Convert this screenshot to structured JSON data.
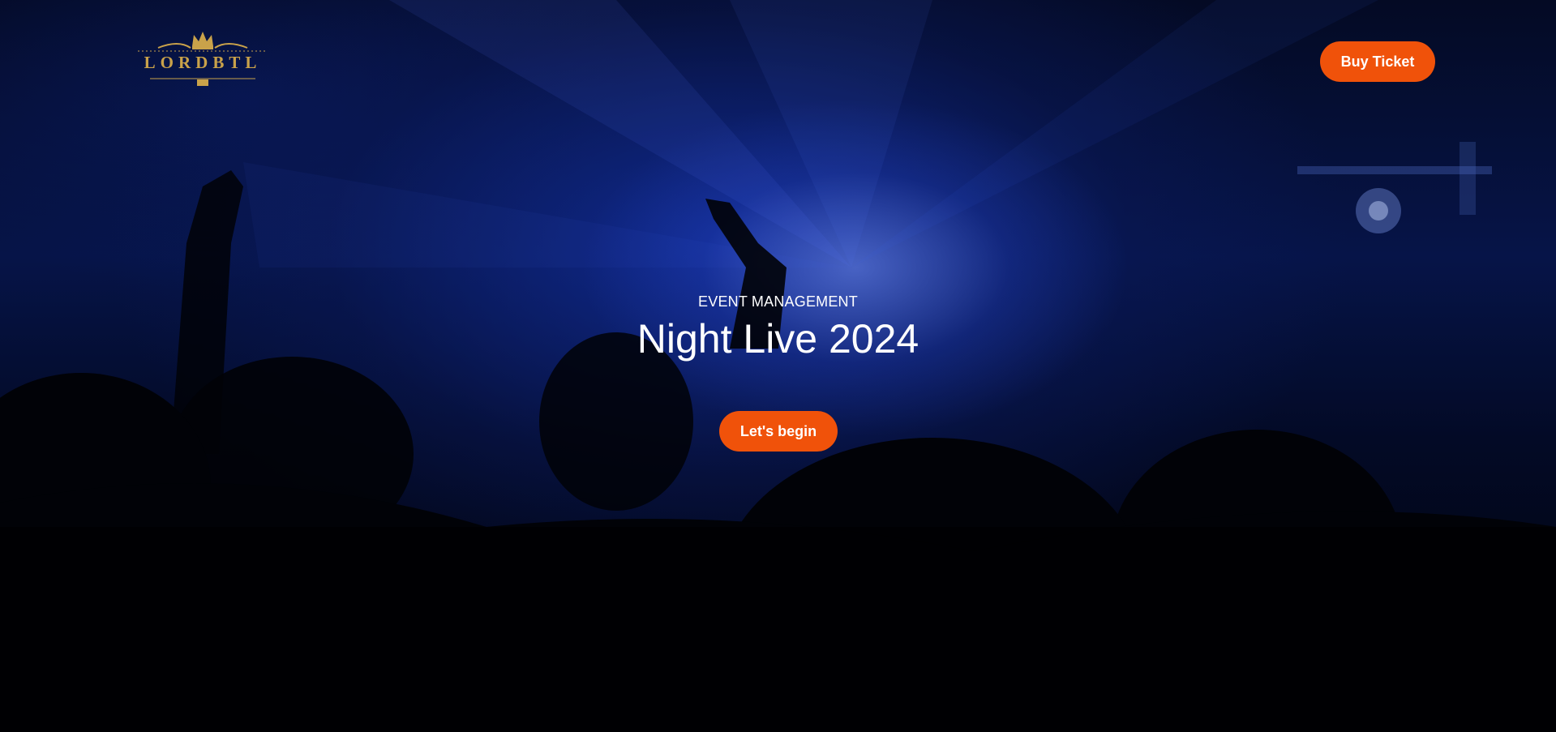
{
  "header": {
    "logo_text": "LORDBTL",
    "buy_ticket_label": "Buy Ticket"
  },
  "hero": {
    "eyebrow": "EVENT MANAGEMENT",
    "title": "Night Live 2024",
    "cta_label": "Let's begin"
  },
  "colors": {
    "accent": "#f0520a",
    "logo_gold": "#c9a24a",
    "background_blue": "#0a1c6e"
  },
  "icons": {
    "logo": "crown-icon"
  }
}
